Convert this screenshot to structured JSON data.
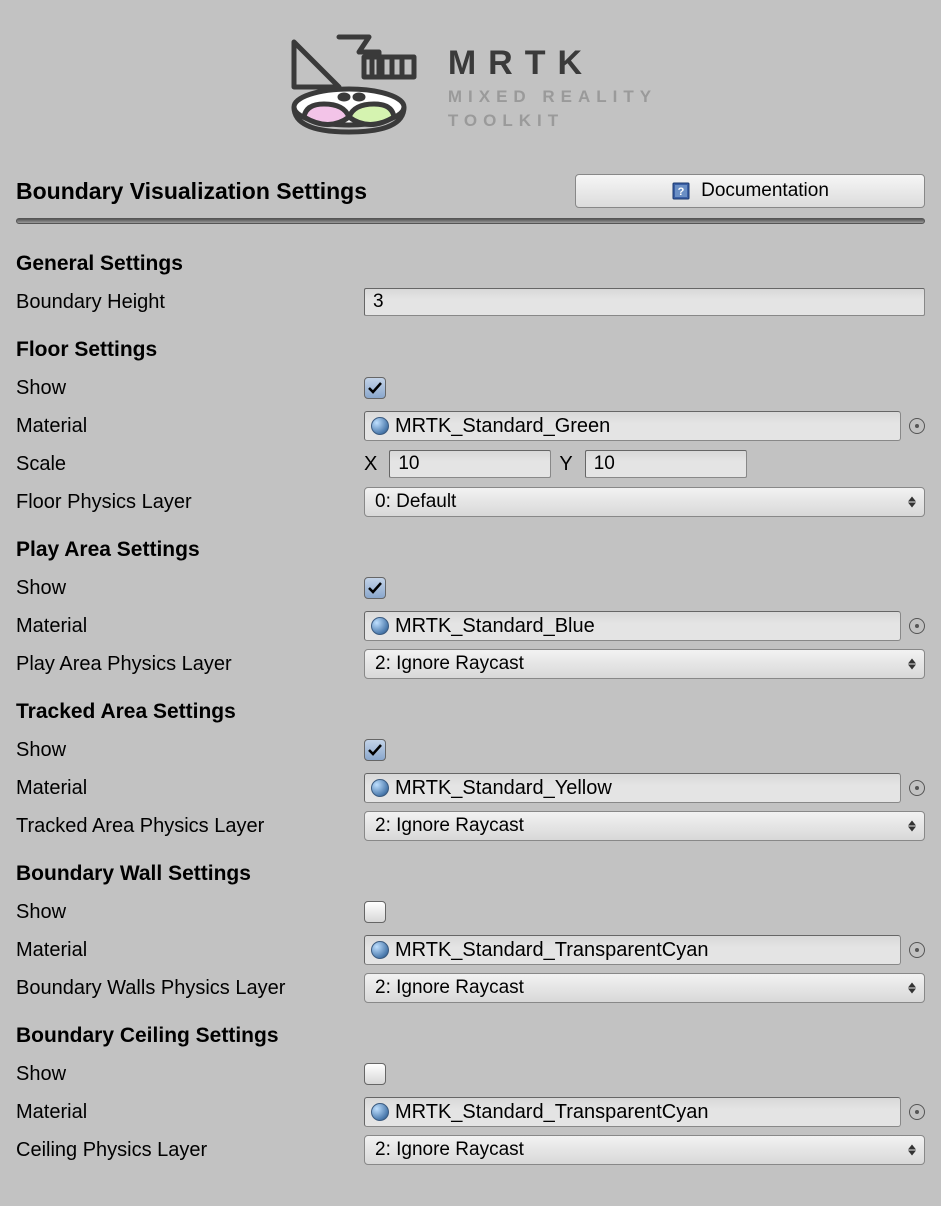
{
  "logo": {
    "title": "MRTK",
    "subtitle1": "MIXED REALITY",
    "subtitle2": "TOOLKIT"
  },
  "page_title": "Boundary Visualization Settings",
  "documentation_label": "Documentation",
  "general": {
    "heading": "General Settings",
    "boundary_height_label": "Boundary Height",
    "boundary_height_value": "3"
  },
  "floor": {
    "heading": "Floor Settings",
    "show_label": "Show",
    "show_value": true,
    "material_label": "Material",
    "material_value": "MRTK_Standard_Green",
    "scale_label": "Scale",
    "scale_x_label": "X",
    "scale_x_value": "10",
    "scale_y_label": "Y",
    "scale_y_value": "10",
    "physics_label": "Floor Physics Layer",
    "physics_value": "0: Default"
  },
  "play_area": {
    "heading": "Play Area Settings",
    "show_label": "Show",
    "show_value": true,
    "material_label": "Material",
    "material_value": "MRTK_Standard_Blue",
    "physics_label": "Play Area Physics Layer",
    "physics_value": "2: Ignore Raycast"
  },
  "tracked_area": {
    "heading": "Tracked Area Settings",
    "show_label": "Show",
    "show_value": true,
    "material_label": "Material",
    "material_value": "MRTK_Standard_Yellow",
    "physics_label": "Tracked Area Physics Layer",
    "physics_value": "2: Ignore Raycast"
  },
  "boundary_wall": {
    "heading": "Boundary Wall Settings",
    "show_label": "Show",
    "show_value": false,
    "material_label": "Material",
    "material_value": "MRTK_Standard_TransparentCyan",
    "physics_label": "Boundary Walls Physics Layer",
    "physics_value": "2: Ignore Raycast"
  },
  "boundary_ceiling": {
    "heading": "Boundary Ceiling Settings",
    "show_label": "Show",
    "show_value": false,
    "material_label": "Material",
    "material_value": "MRTK_Standard_TransparentCyan",
    "physics_label": "Ceiling Physics Layer",
    "physics_value": "2: Ignore Raycast"
  }
}
